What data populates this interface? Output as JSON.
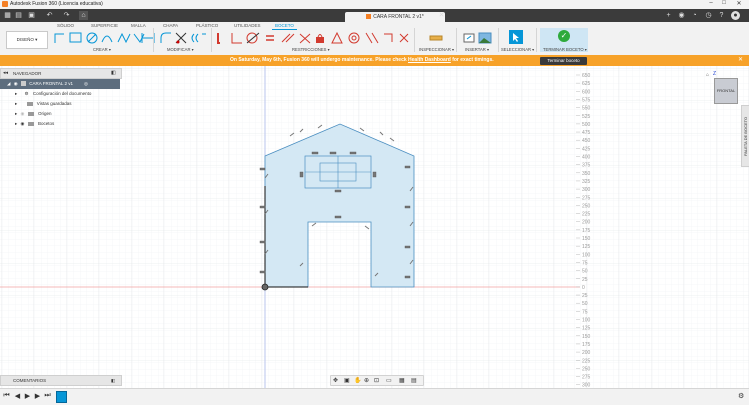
{
  "window": {
    "title": "Autodesk Fusion 360 (Licencia educativa)"
  },
  "document_tab": {
    "title": "CARA FRONTAL 2 v1*"
  },
  "ribbon": {
    "tabs": [
      "SÓLIDO",
      "SUPERFICIE",
      "MALLA",
      "CHAPA",
      "PLÁSTICO",
      "UTILIDADES",
      "BOCETO"
    ],
    "active_tab": "BOCETO",
    "workspace": "DISEÑO ▾",
    "groups": {
      "create": "CREAR ▾",
      "modify": "MODIFICAR ▾",
      "constraints": "RESTRICCIONES ▾",
      "inspect": "INSPECCIONAR ▾",
      "insert": "INSERTAR ▾",
      "select": "SELECCIONAR ▾",
      "finish": "TERMINAR BOCETO ▾"
    }
  },
  "banner": {
    "message_start": "On Saturday, May 6th, Fusion 360 will undergo maintenance. Please check ",
    "link": "Health Dashboard",
    "message_end": " for exact timings.",
    "button": "Terminar boceto",
    "color": "#f7a229"
  },
  "navigator": {
    "title": "NAVEGADOR",
    "items": [
      {
        "label": "CARA FRONTAL 2 v1"
      },
      {
        "label": "Configuración del documento"
      },
      {
        "label": "Vistas guardadas"
      },
      {
        "label": "Origen"
      },
      {
        "label": "Bocetos"
      }
    ]
  },
  "comments": {
    "label": "COMENTARIOS"
  },
  "viewcube": {
    "label": "FRONTAL",
    "axis": "Z"
  },
  "browser_tab": {
    "label": "PALETA DE BOCETO"
  },
  "ruler": {
    "values": [
      "650",
      "625",
      "600",
      "575",
      "550",
      "525",
      "500",
      "475",
      "450",
      "425",
      "400",
      "375",
      "350",
      "325",
      "300",
      "275",
      "250",
      "225",
      "200",
      "175",
      "150",
      "125",
      "100",
      "75",
      "50",
      "25",
      "0",
      "25",
      "50",
      "75",
      "100",
      "125",
      "150",
      "175",
      "200",
      "225",
      "250",
      "275",
      "300"
    ]
  },
  "colors": {
    "accent": "#0696d7",
    "sketch_fill": "#d4e8f4",
    "sketch_stroke": "#4a8ec0",
    "finish_green": "#2eaa3c"
  }
}
